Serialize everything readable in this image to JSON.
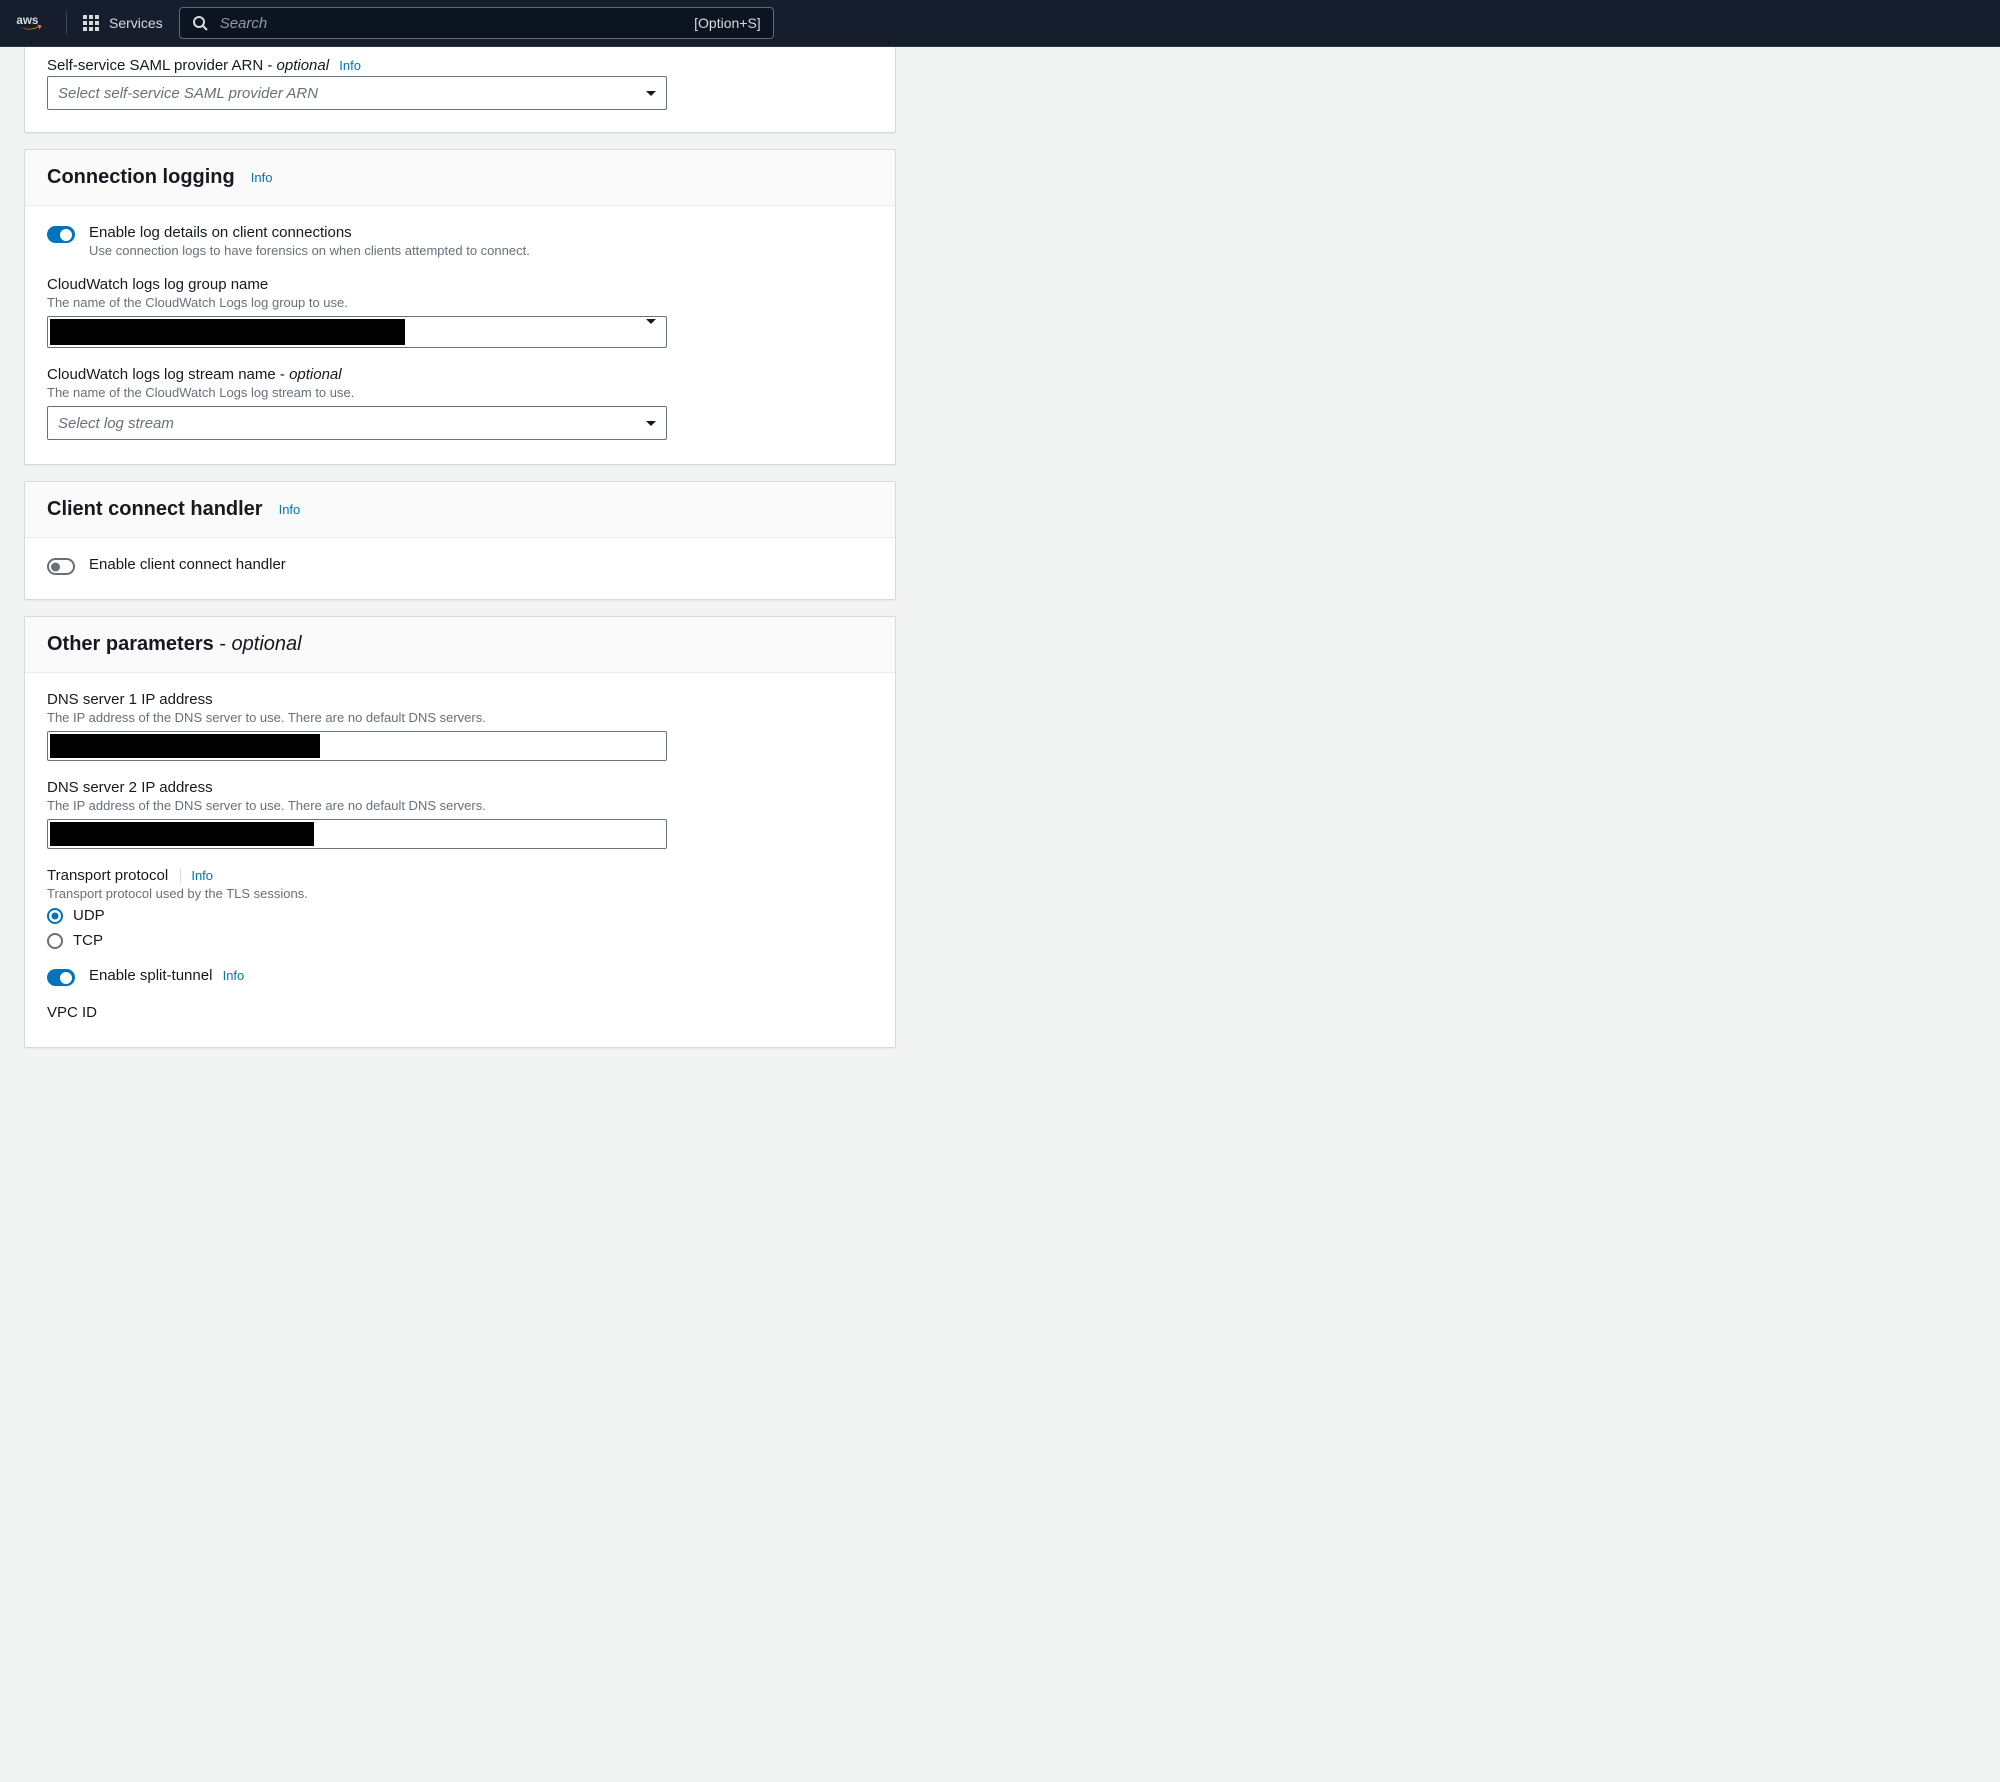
{
  "nav": {
    "services_label": "Services",
    "search_placeholder": "Search",
    "search_hint": "[Option+S]"
  },
  "saml": {
    "label_prefix": "Self-service SAML provider ARN",
    "optional_suffix": "optional",
    "info": "Info",
    "select_placeholder": "Select self-service SAML provider ARN"
  },
  "conn_logging": {
    "title": "Connection logging",
    "info": "Info",
    "toggle_title": "Enable log details on client connections",
    "toggle_desc": "Use connection logs to have forensics on when clients attempted to connect.",
    "cw_group_label": "CloudWatch logs log group name",
    "cw_group_desc": "The name of the CloudWatch Logs log group to use.",
    "cw_stream_label_prefix": "CloudWatch logs log stream name",
    "optional_suffix": "optional",
    "cw_stream_desc": "The name of the CloudWatch Logs log stream to use.",
    "cw_stream_placeholder": "Select log stream"
  },
  "connect_handler": {
    "title": "Client connect handler",
    "info": "Info",
    "toggle_title": "Enable client connect handler"
  },
  "other": {
    "title_prefix": "Other parameters",
    "optional_suffix": "optional",
    "dns1_label": "DNS server 1 IP address",
    "dns1_desc": "The IP address of the DNS server to use. There are no default DNS servers.",
    "dns2_label": "DNS server 2 IP address",
    "dns2_desc": "The IP address of the DNS server to use. There are no default DNS servers.",
    "transport_label": "Transport protocol",
    "transport_info": "Info",
    "transport_desc": "Transport protocol used by the TLS sessions.",
    "transport_opts": {
      "udp": "UDP",
      "tcp": "TCP"
    },
    "split_tunnel_label": "Enable split-tunnel",
    "split_tunnel_info": "Info",
    "vpc_id_label": "VPC ID"
  }
}
